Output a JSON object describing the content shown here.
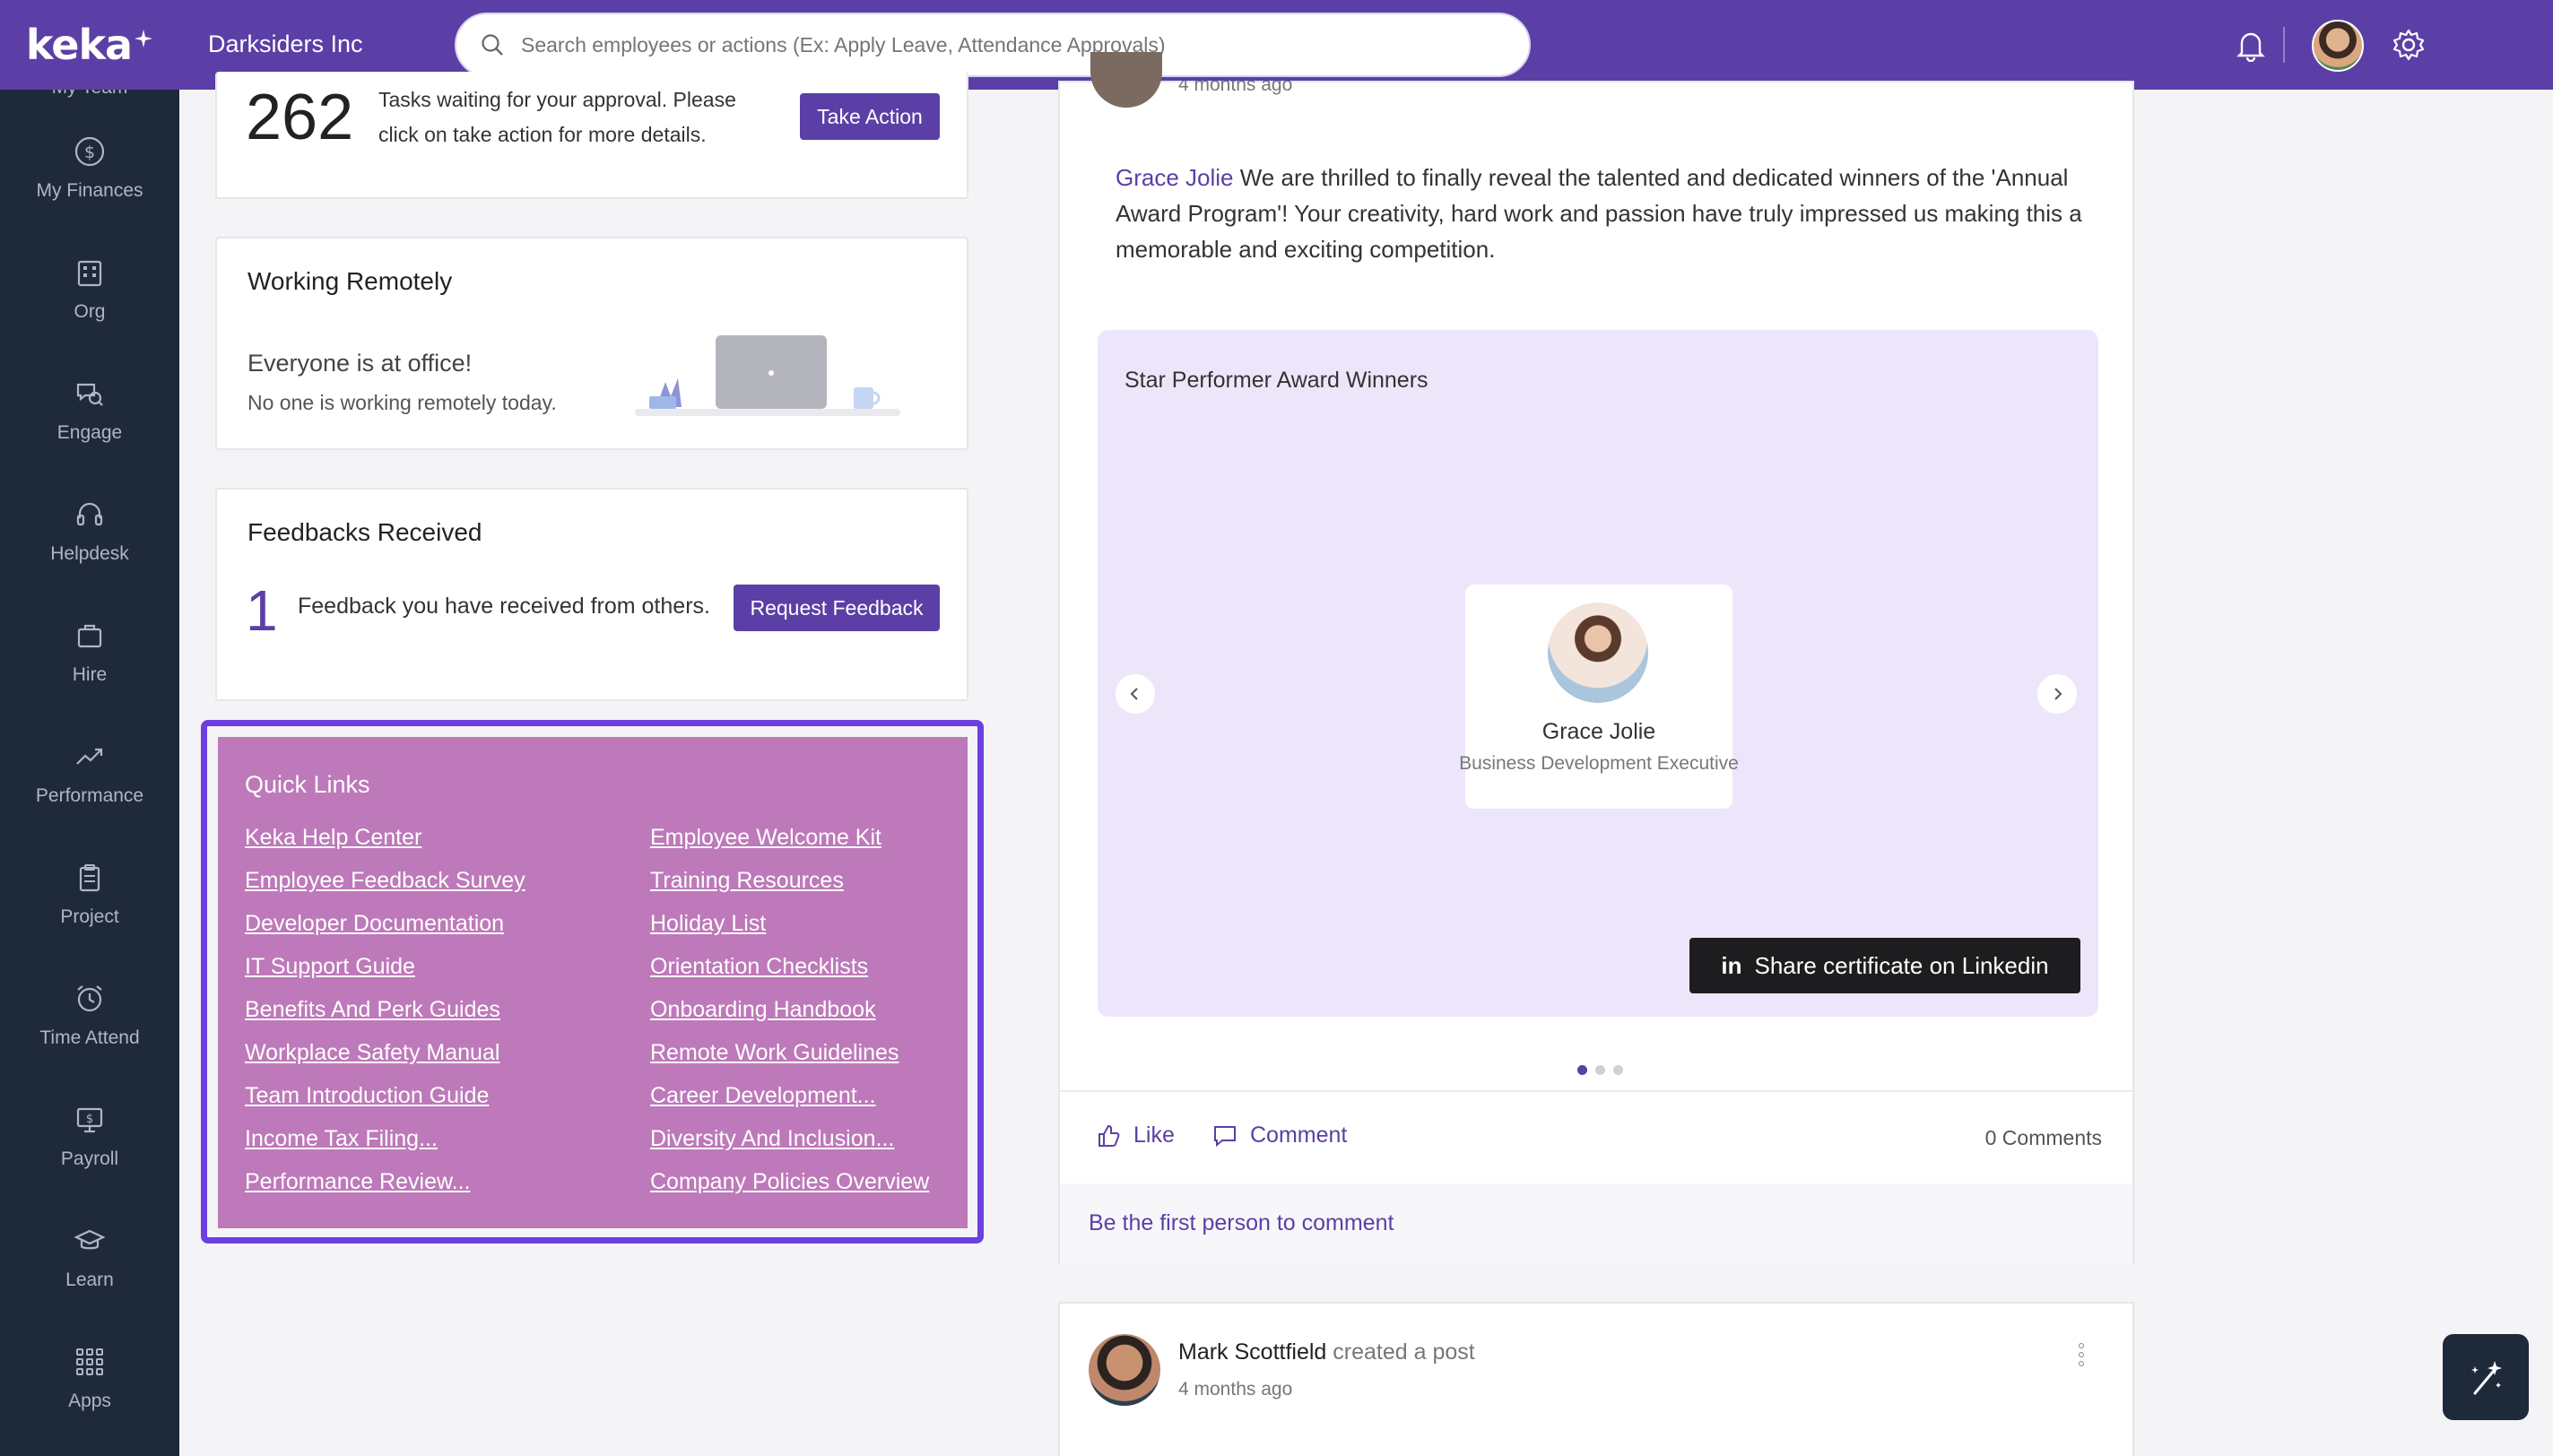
{
  "brand": {
    "logo": "keka",
    "purple": "#5b3fa6",
    "sidebar_bg": "#1e2a3a",
    "quicklinks_bg": "#bd79b9",
    "highlight": "#6b3fe0"
  },
  "header": {
    "company": "Darksiders Inc",
    "search_placeholder": "Search employees or actions (Ex: Apply Leave, Attendance Approvals)",
    "icons": [
      "bell-icon",
      "rocket-icon",
      "gear-icon",
      "user-avatar"
    ]
  },
  "sidebar": {
    "partial_item": "My Team",
    "items": [
      {
        "label": "My Finances",
        "icon": "dollar-icon"
      },
      {
        "label": "Org",
        "icon": "org-icon"
      },
      {
        "label": "Engage",
        "icon": "engage-icon"
      },
      {
        "label": "Helpdesk",
        "icon": "headset-icon"
      },
      {
        "label": "Hire",
        "icon": "briefcase-icon"
      },
      {
        "label": "Performance",
        "icon": "trend-icon"
      },
      {
        "label": "Project",
        "icon": "clipboard-icon"
      },
      {
        "label": "Time Attend",
        "icon": "alarm-icon"
      },
      {
        "label": "Payroll",
        "icon": "payroll-icon"
      },
      {
        "label": "Learn",
        "icon": "graduation-icon"
      },
      {
        "label": "Apps",
        "icon": "grid-icon"
      }
    ]
  },
  "approvals": {
    "count": "262",
    "text": "Tasks waiting for your approval. Please click on take action for more details.",
    "button": "Take Action"
  },
  "remote": {
    "title": "Working Remotely",
    "headline": "Everyone is at office!",
    "sub": "No one is working remotely today."
  },
  "feedback": {
    "title": "Feedbacks Received",
    "count": "1",
    "text": "Feedback you have received from others.",
    "button": "Request Feedback"
  },
  "quick_links": {
    "title": "Quick Links",
    "left": [
      "Keka Help Center",
      "Employee Feedback Survey",
      "Developer Documentation",
      "IT Support Guide",
      "Benefits And Perk Guides",
      "Workplace Safety Manual",
      "Team Introduction Guide",
      "Income Tax Filing...",
      "Performance Review..."
    ],
    "right": [
      "Employee Welcome Kit",
      "Training Resources",
      "Holiday List",
      "Orientation Checklists",
      "Onboarding Handbook",
      "Remote Work Guidelines",
      "Career Development...",
      "Diversity And Inclusion...",
      "Company Policies Overview"
    ]
  },
  "post": {
    "time_partial": "4 months ago",
    "mention": "Grace Jolie",
    "body": " We are thrilled to finally reveal the talented and dedicated winners of the 'Annual Award Program'! Your creativity, hard work and passion have truly impressed us making this a memorable and exciting competition.",
    "award_title": "Star Performer Award Winners",
    "winner_name": "Grace Jolie",
    "winner_role": "Business Development Executive",
    "share_button": "Share certificate on Linkedin",
    "share_icon": "in",
    "carousel_pages": 3,
    "carousel_active": 1,
    "like": "Like",
    "comment": "Comment",
    "comments_count": "0 Comments",
    "first_comment": "Be the first person to comment"
  },
  "post2": {
    "author": "Mark Scottfield",
    "action": "created a post",
    "time": "4 months ago"
  }
}
